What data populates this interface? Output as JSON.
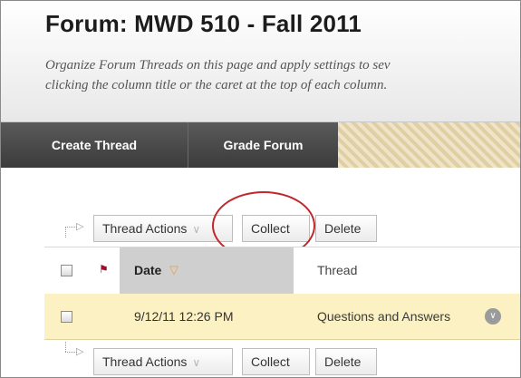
{
  "page": {
    "title": "Forum: MWD 510 - Fall 2011",
    "description_lines": [
      "Organize Forum Threads on this page and apply settings to sev",
      "clicking the column title or the caret at the top of each column."
    ]
  },
  "nav": {
    "create_thread": "Create Thread",
    "grade_forum": "Grade Forum"
  },
  "toolbar_top": {
    "thread_actions": "Thread Actions",
    "collect": "Collect",
    "delete": "Delete"
  },
  "table": {
    "columns": {
      "date": "Date",
      "thread": "Thread"
    },
    "rows": [
      {
        "date": "9/12/11 12:26 PM",
        "thread": "Questions and Answers"
      }
    ]
  },
  "toolbar_bottom": {
    "thread_actions": "Thread Actions",
    "collect": "Collect",
    "delete": "Delete"
  },
  "icons": {
    "flag": "flag-icon",
    "caret": "caret-down-icon",
    "chevron": "chevron-down-icon",
    "row_menu": "row-menu-icon"
  },
  "colors": {
    "nav_background": "#4a4a4a",
    "date_column_highlight": "#cfcfcf",
    "row_highlight": "#fbf1c3",
    "annotation_circle": "#c1272d"
  }
}
